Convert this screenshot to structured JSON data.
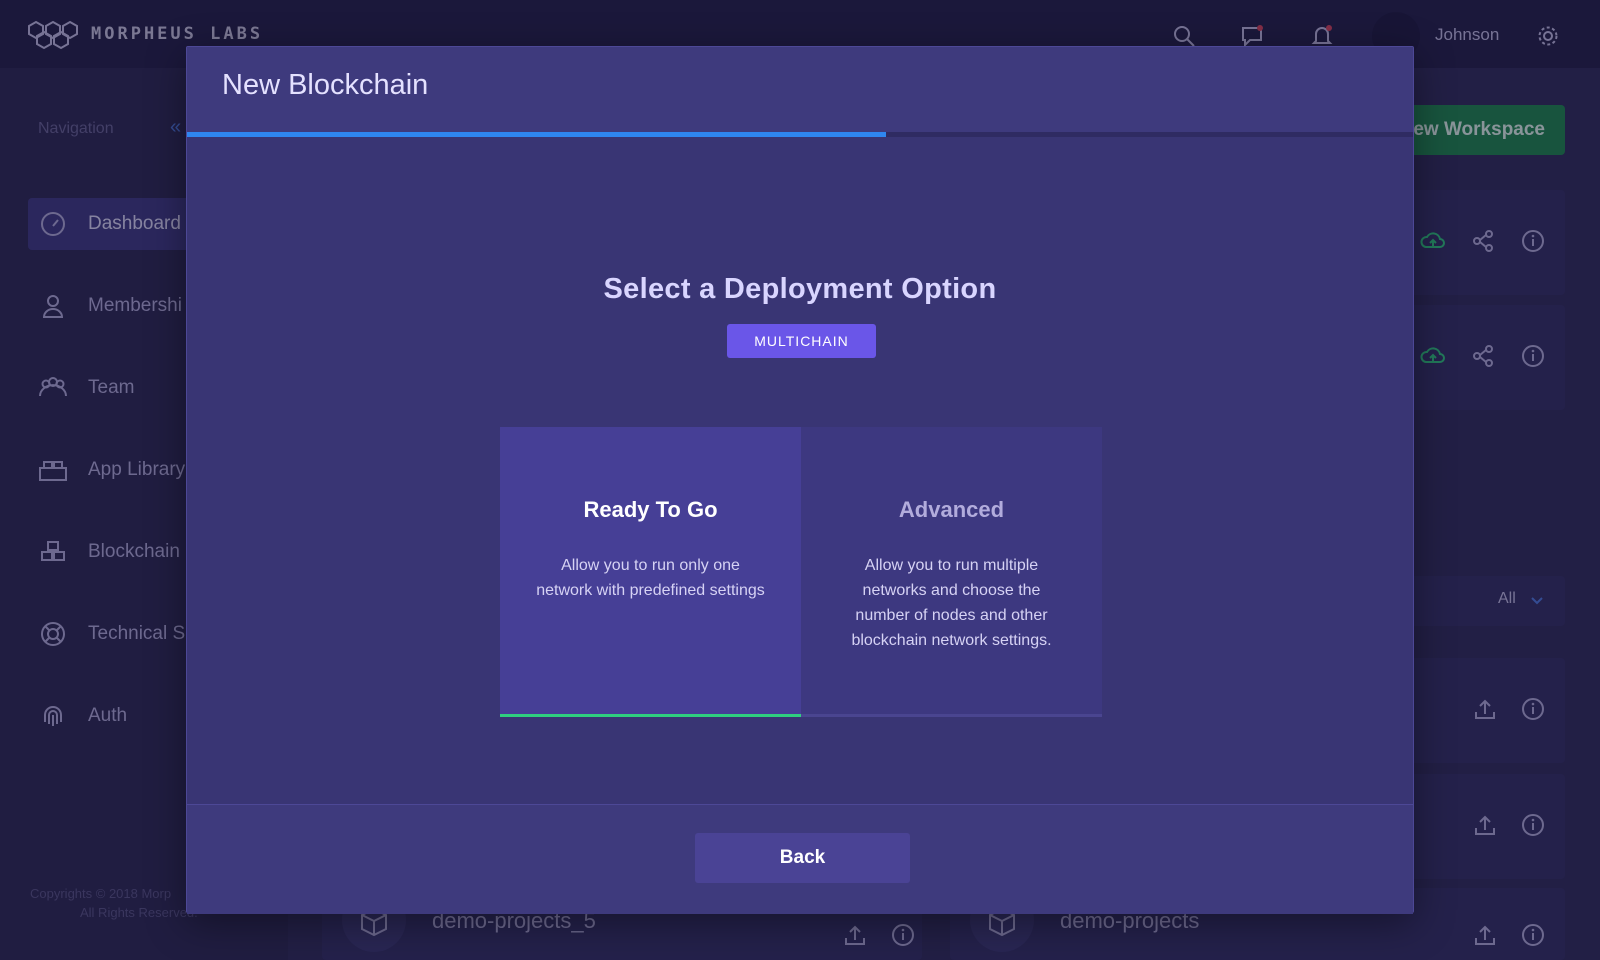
{
  "topbar": {
    "brand": "MORPHEUS LABS",
    "username": "Johnson",
    "icons": [
      "search-icon",
      "chat-icon",
      "bell-icon",
      "gear-icon"
    ]
  },
  "sidebar": {
    "title": "Navigation",
    "collapse_glyph": "«",
    "items": [
      {
        "label": "Dashboard",
        "icon": "dashboard-icon"
      },
      {
        "label": "Membershi",
        "icon": "user-icon"
      },
      {
        "label": "Team",
        "icon": "team-icon"
      },
      {
        "label": "App Library",
        "icon": "app-library-icon"
      },
      {
        "label": "Blockchain",
        "icon": "blockchain-icon"
      },
      {
        "label": "Technical S",
        "icon": "lifebuoy-icon"
      },
      {
        "label": "Auth",
        "icon": "fingerprint-icon"
      }
    ],
    "copyright_line1": "Copyrights © 2018 Morp",
    "copyright_line2": "All Rights Reserved."
  },
  "main": {
    "new_workspace_label": "lew Workspace",
    "filter_value": "All",
    "projects": [
      {
        "name": "demo-projects_5"
      },
      {
        "name": "demo-projects"
      }
    ]
  },
  "modal": {
    "title": "New Blockchain",
    "progress_fraction": 0.57,
    "section_title": "Select a Deployment Option",
    "chain_badge": "MULTICHAIN",
    "options": [
      {
        "title": "Ready To Go",
        "description": "Allow you to run only one network with predefined settings",
        "selected": true
      },
      {
        "title": "Advanced",
        "description": "Allow you to run multiple networks and choose the number of nodes and other blockchain network settings.",
        "selected": false
      }
    ],
    "back_label": "Back"
  },
  "colors": {
    "accent_green": "#2fd080",
    "progress_blue": "#2f86f0",
    "badge_purple": "#6a56e8"
  }
}
